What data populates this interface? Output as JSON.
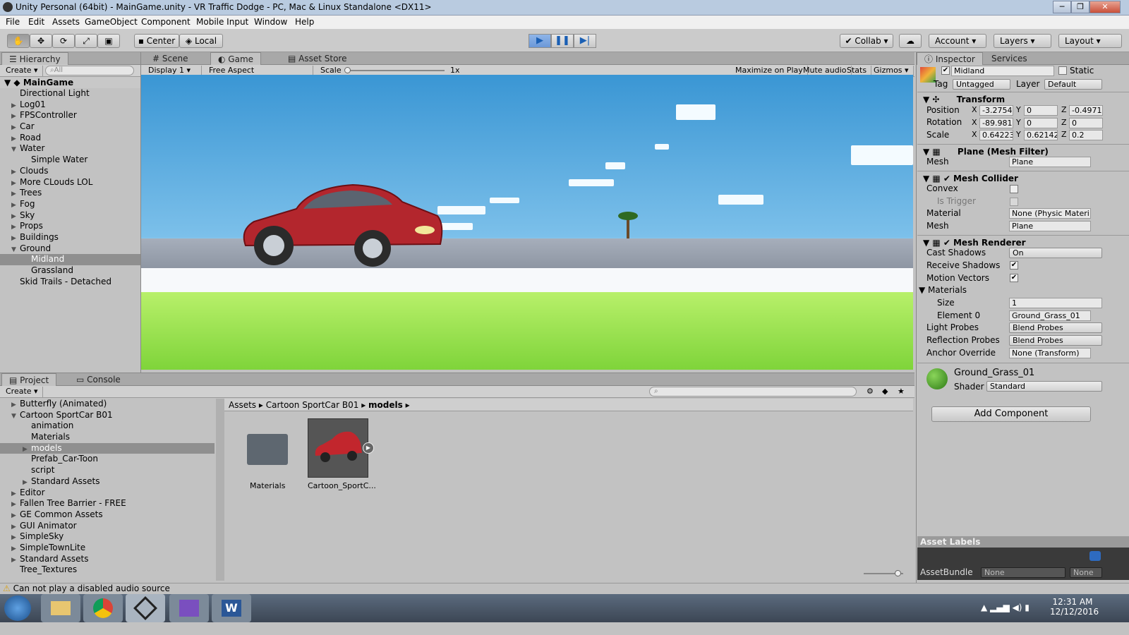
{
  "window": {
    "title": "Unity Personal (64bit) - MainGame.unity - VR Traffic Dodge - PC, Mac & Linux Standalone <DX11>"
  },
  "menu": [
    "File",
    "Edit",
    "Assets",
    "GameObject",
    "Component",
    "Mobile Input",
    "Window",
    "Help"
  ],
  "toolbar": {
    "pivot": "Center",
    "space": "Local",
    "collab": "Collab",
    "account": "Account",
    "layers": "Layers",
    "layout": "Layout"
  },
  "hierarchy": {
    "tab": "Hierarchy",
    "create": "Create",
    "search_placeholder": "All",
    "scene": "MainGame",
    "items": [
      {
        "label": "Directional Light",
        "indent": 0,
        "arrow": ""
      },
      {
        "label": "Log01",
        "indent": 0,
        "arrow": "▶"
      },
      {
        "label": "FPSController",
        "indent": 0,
        "arrow": "▶"
      },
      {
        "label": "Car",
        "indent": 0,
        "arrow": "▶"
      },
      {
        "label": "Road",
        "indent": 0,
        "arrow": "▶"
      },
      {
        "label": "Water",
        "indent": 0,
        "arrow": "▼"
      },
      {
        "label": "Simple Water",
        "indent": 1,
        "arrow": ""
      },
      {
        "label": "Clouds",
        "indent": 0,
        "arrow": "▶"
      },
      {
        "label": "More CLouds LOL",
        "indent": 0,
        "arrow": "▶"
      },
      {
        "label": "Trees",
        "indent": 0,
        "arrow": "▶"
      },
      {
        "label": "Fog",
        "indent": 0,
        "arrow": "▶"
      },
      {
        "label": "Sky",
        "indent": 0,
        "arrow": "▶"
      },
      {
        "label": "Props",
        "indent": 0,
        "arrow": "▶"
      },
      {
        "label": "Buildings",
        "indent": 0,
        "arrow": "▶"
      },
      {
        "label": "Ground",
        "indent": 0,
        "arrow": "▼"
      },
      {
        "label": "Midland",
        "indent": 1,
        "arrow": "",
        "selected": true
      },
      {
        "label": "Grassland",
        "indent": 1,
        "arrow": ""
      },
      {
        "label": "Skid Trails - Detached",
        "indent": 0,
        "arrow": ""
      }
    ]
  },
  "center_tabs": {
    "scene": "Scene",
    "game": "Game",
    "store": "Asset Store"
  },
  "game_bar": {
    "display": "Display 1",
    "aspect": "Free Aspect",
    "scale_label": "Scale",
    "scale_value": "1x",
    "maximize": "Maximize on Play",
    "mute": "Mute audio",
    "stats": "Stats",
    "gizmos": "Gizmos"
  },
  "inspector": {
    "tab": "Inspector",
    "services": "Services",
    "name": "Midland",
    "static": "Static",
    "tag_label": "Tag",
    "tag": "Untagged",
    "layer_label": "Layer",
    "layer": "Default",
    "transform": {
      "title": "Transform",
      "position": "Position",
      "rotation": "Rotation",
      "scale": "Scale",
      "px": "-3.2754",
      "py": "0",
      "pz": "-0.4971",
      "rx": "-89.981",
      "ry": "0",
      "rz": "0",
      "sx": "0.64223",
      "sy": "0.62142",
      "sz": "0.2"
    },
    "mesh_filter": {
      "title": "Plane (Mesh Filter)",
      "mesh_label": "Mesh",
      "mesh": "Plane"
    },
    "collider": {
      "title": "Mesh Collider",
      "convex": "Convex",
      "trigger": "Is Trigger",
      "material_label": "Material",
      "material": "None (Physic Materi",
      "mesh_label": "Mesh",
      "mesh": "Plane"
    },
    "renderer": {
      "title": "Mesh Renderer",
      "cast": "Cast Shadows",
      "cast_val": "On",
      "receive": "Receive Shadows",
      "motion": "Motion Vectors",
      "materials": "Materials",
      "size_label": "Size",
      "size": "1",
      "element_label": "Element 0",
      "element": "Ground_Grass_01",
      "light_label": "Light Probes",
      "light": "Blend Probes",
      "refl_label": "Reflection Probes",
      "refl": "Blend Probes",
      "anchor_label": "Anchor Override",
      "anchor": "None (Transform)"
    },
    "material": {
      "name": "Ground_Grass_01",
      "shader_label": "Shader",
      "shader": "Standard"
    },
    "add_component": "Add Component",
    "asset_labels": "Asset Labels",
    "asset_bundle": "AssetBundle",
    "bundle_val": "None",
    "bundle_var": "None"
  },
  "project": {
    "tab": "Project",
    "console": "Console",
    "create": "Create",
    "tree": [
      {
        "label": "Butterfly (Animated)",
        "indent": 0,
        "arrow": "▶"
      },
      {
        "label": "Cartoon SportCar B01",
        "indent": 0,
        "arrow": "▼"
      },
      {
        "label": "animation",
        "indent": 1,
        "arrow": ""
      },
      {
        "label": "Materials",
        "indent": 1,
        "arrow": ""
      },
      {
        "label": "models",
        "indent": 1,
        "arrow": "▶",
        "selected": true
      },
      {
        "label": "Prefab_Car-Toon",
        "indent": 1,
        "arrow": ""
      },
      {
        "label": "script",
        "indent": 1,
        "arrow": ""
      },
      {
        "label": "Standard Assets",
        "indent": 1,
        "arrow": "▶"
      },
      {
        "label": "Editor",
        "indent": 0,
        "arrow": "▶"
      },
      {
        "label": "Fallen Tree Barrier - FREE",
        "indent": 0,
        "arrow": "▶"
      },
      {
        "label": "GE Common Assets",
        "indent": 0,
        "arrow": "▶"
      },
      {
        "label": "GUI Animator",
        "indent": 0,
        "arrow": "▶"
      },
      {
        "label": "SimpleSky",
        "indent": 0,
        "arrow": "▶"
      },
      {
        "label": "SimpleTownLite",
        "indent": 0,
        "arrow": "▶"
      },
      {
        "label": "Standard Assets",
        "indent": 0,
        "arrow": "▶"
      },
      {
        "label": "Tree_Textures",
        "indent": 0,
        "arrow": ""
      }
    ],
    "breadcrumb": [
      "Assets",
      "Cartoon SportCar B01",
      "models"
    ],
    "assets": [
      "Materials",
      "Cartoon_SportC..."
    ]
  },
  "status": {
    "message": "Can not play a disabled audio source"
  },
  "taskbar": {
    "time": "12:31 AM",
    "date": "12/12/2016"
  }
}
